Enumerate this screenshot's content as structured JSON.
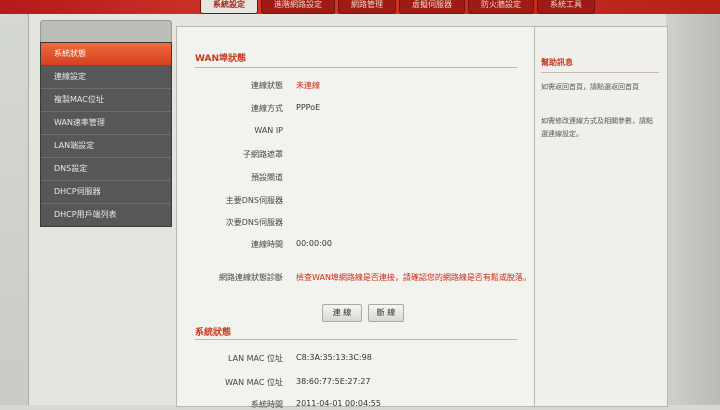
{
  "nav": {
    "tabs": [
      {
        "label": "系統設定",
        "active": true
      },
      {
        "label": "進階網路設定",
        "active": false
      },
      {
        "label": "網路管理",
        "active": false
      },
      {
        "label": "虛擬伺服器",
        "active": false
      },
      {
        "label": "防火牆設定",
        "active": false
      },
      {
        "label": "系統工具",
        "active": false
      }
    ]
  },
  "sidebar": {
    "items": [
      {
        "label": "系統狀態",
        "active": true
      },
      {
        "label": "連線設定",
        "active": false
      },
      {
        "label": "複製MAC位址",
        "active": false
      },
      {
        "label": "WAN速率管理",
        "active": false
      },
      {
        "label": "LAN端設定",
        "active": false
      },
      {
        "label": "DNS設定",
        "active": false
      },
      {
        "label": "DHCP伺服器",
        "active": false
      },
      {
        "label": "DHCP用戶端列表",
        "active": false
      }
    ]
  },
  "wan": {
    "title": "WAN埠狀態",
    "rows": [
      {
        "label": "連線狀態",
        "value": "未連線"
      },
      {
        "label": "連線方式",
        "value": "PPPoE"
      },
      {
        "label": "WAN IP",
        "value": ""
      },
      {
        "label": "子網路遮罩",
        "value": ""
      },
      {
        "label": "預設閘道",
        "value": ""
      },
      {
        "label": "主要DNS伺服器",
        "value": ""
      },
      {
        "label": "次要DNS伺服器",
        "value": ""
      },
      {
        "label": "連線時間",
        "value": "00:00:00"
      }
    ],
    "diag_label": "網路連線狀態診斷",
    "diag_value": "檢查WAN埠網路線是否連接，請確認您的網路線是否有鬆或脫落。",
    "connect_button": "連 線",
    "disconnect_button": "斷 線"
  },
  "system": {
    "title": "系統狀態",
    "rows": [
      {
        "label": "LAN MAC 位址",
        "value": "C8:3A:35:13:3C:98"
      },
      {
        "label": "WAN MAC 位址",
        "value": "38:60:77:5E:27:27"
      },
      {
        "label": "系統時間",
        "value": "2011-04-01 00:04:55"
      }
    ]
  },
  "help": {
    "title": "幫助訊息",
    "p1": "如需返回首頁，請點選返回首頁",
    "p2": "如需修改連線方式及相關參數，請點選連線設定。"
  },
  "colors": {
    "accent": "#c63a1f",
    "nav_bg": "#b31a1a",
    "sidebar_active": "#e65530"
  }
}
